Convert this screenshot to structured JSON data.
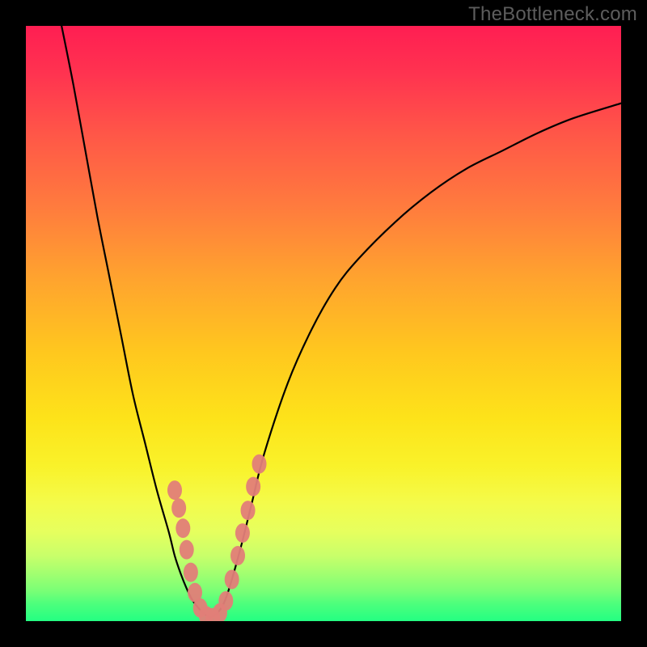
{
  "watermark": "TheBottleneck.com",
  "colors": {
    "frame_bg": "#000000",
    "watermark_fg": "#5d5d5d",
    "curve_stroke": "#000000",
    "marker_fill": "#e27e78",
    "gradient_stops": [
      "#ff1e52",
      "#ff3350",
      "#ff5648",
      "#ff7a3e",
      "#ffa22f",
      "#ffc81e",
      "#fde31a",
      "#f9f22a",
      "#f4fb4a",
      "#e6ff5e",
      "#c9ff6a",
      "#a2ff70",
      "#78ff76",
      "#4eff7c",
      "#24ff82"
    ]
  },
  "chart_data": {
    "type": "line",
    "title": "",
    "xlabel": "",
    "ylabel": "",
    "xlim": [
      0,
      100
    ],
    "ylim": [
      0,
      100
    ],
    "note": "Bottleneck V-curve. No axis ticks or numeric labels are rendered; values are positional estimates (0-100) read from pixel geometry, with 100 at the top and 0 at the bottom.",
    "series": [
      {
        "name": "left-branch",
        "x": [
          6,
          8,
          10,
          12,
          14,
          16,
          18,
          20,
          22,
          24,
          25,
          26,
          27,
          28,
          29,
          30,
          31
        ],
        "values": [
          100,
          90,
          79,
          68,
          58,
          48,
          38,
          30,
          22,
          15,
          11,
          8,
          5.5,
          3.5,
          2.2,
          1.2,
          0.6
        ]
      },
      {
        "name": "right-branch",
        "x": [
          31,
          32,
          33,
          34,
          36,
          38,
          40,
          44,
          48,
          52,
          56,
          62,
          68,
          74,
          80,
          86,
          92,
          100
        ],
        "values": [
          0.6,
          1.2,
          2.5,
          5,
          12,
          20,
          28,
          40,
          49,
          56,
          61,
          67,
          72,
          76,
          79,
          82,
          84.5,
          87
        ]
      },
      {
        "name": "markers",
        "note": "Salmon-colored rounded markers clustered around the minimum of the V.",
        "points": [
          {
            "x": 25.0,
            "y": 22.0
          },
          {
            "x": 25.7,
            "y": 19.0
          },
          {
            "x": 26.4,
            "y": 15.6
          },
          {
            "x": 27.0,
            "y": 12.0
          },
          {
            "x": 27.7,
            "y": 8.2
          },
          {
            "x": 28.4,
            "y": 4.8
          },
          {
            "x": 29.3,
            "y": 2.2
          },
          {
            "x": 30.3,
            "y": 0.9
          },
          {
            "x": 31.4,
            "y": 0.6
          },
          {
            "x": 32.6,
            "y": 1.4
          },
          {
            "x": 33.6,
            "y": 3.4
          },
          {
            "x": 34.6,
            "y": 7.0
          },
          {
            "x": 35.6,
            "y": 11.0
          },
          {
            "x": 36.4,
            "y": 14.8
          },
          {
            "x": 37.3,
            "y": 18.6
          },
          {
            "x": 38.2,
            "y": 22.6
          },
          {
            "x": 39.2,
            "y": 26.4
          }
        ]
      }
    ]
  }
}
